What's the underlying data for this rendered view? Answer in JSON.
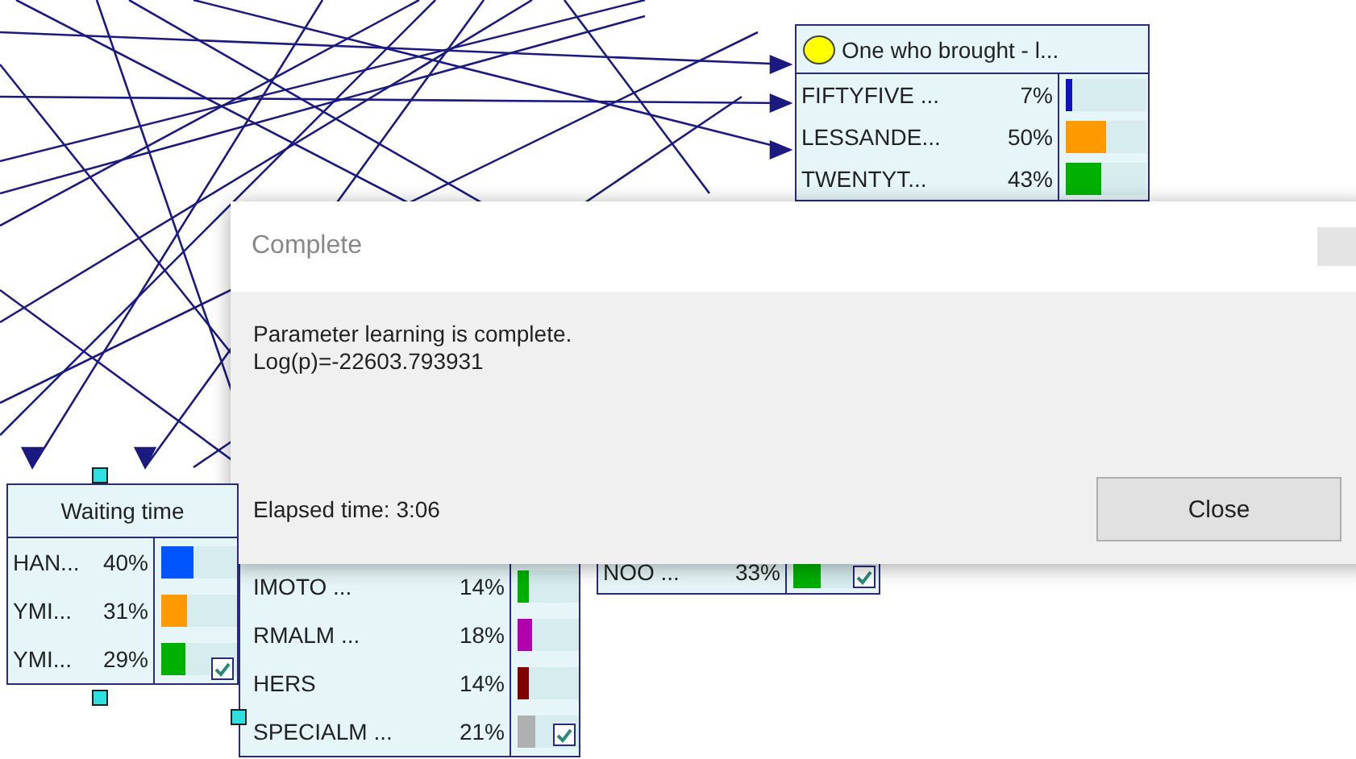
{
  "nodes": [
    {
      "title": "One who brought - l...",
      "color": "#ffff00",
      "rows": [
        {
          "label": "FIFTYFIVE ...",
          "percent": "7%",
          "level": 0.07,
          "color": "#1010c0"
        },
        {
          "label": "LESSANDE...",
          "percent": "50%",
          "level": 0.5,
          "color": "#ff9900"
        },
        {
          "label": "TWENTYT...",
          "percent": "43%",
          "level": 0.43,
          "color": "#00b000"
        }
      ]
    },
    {
      "title": "Waiting time",
      "rows": [
        {
          "label": "HAN...",
          "percent": "40%",
          "level": 0.4,
          "color": "#0055ff"
        },
        {
          "label": "YMI...",
          "percent": "31%",
          "level": 0.31,
          "color": "#ff9900"
        },
        {
          "label": "YMI...",
          "percent": "29%",
          "level": 0.29,
          "color": "#00b000"
        }
      ],
      "checkbox": {
        "checked": true
      }
    },
    {
      "rows": [
        {
          "label": "IMOTO ...",
          "percent": "14%",
          "level": 0.14,
          "color": "#00b000"
        },
        {
          "label": "RMALM ...",
          "percent": "18%",
          "level": 0.18,
          "color": "#b000b0"
        },
        {
          "label": "HERS",
          "percent": "14%",
          "level": 0.14,
          "color": "#800000"
        },
        {
          "label": "SPECIALM ...",
          "percent": "21%",
          "level": 0.21,
          "color": "#b0b0b0"
        }
      ],
      "checkbox": {
        "checked": true
      }
    },
    {
      "rows": [
        {
          "label": "NOO ...",
          "percent": "33%",
          "level": 0.33,
          "color": "#00b000"
        }
      ],
      "checkbox": {
        "checked": true
      }
    }
  ],
  "dialog": {
    "title": "Complete",
    "message": "Parameter learning is complete.",
    "log_line": "Log(p)=-22603.793931",
    "elapsed": "Elapsed time: 3:06",
    "button": "Close"
  }
}
